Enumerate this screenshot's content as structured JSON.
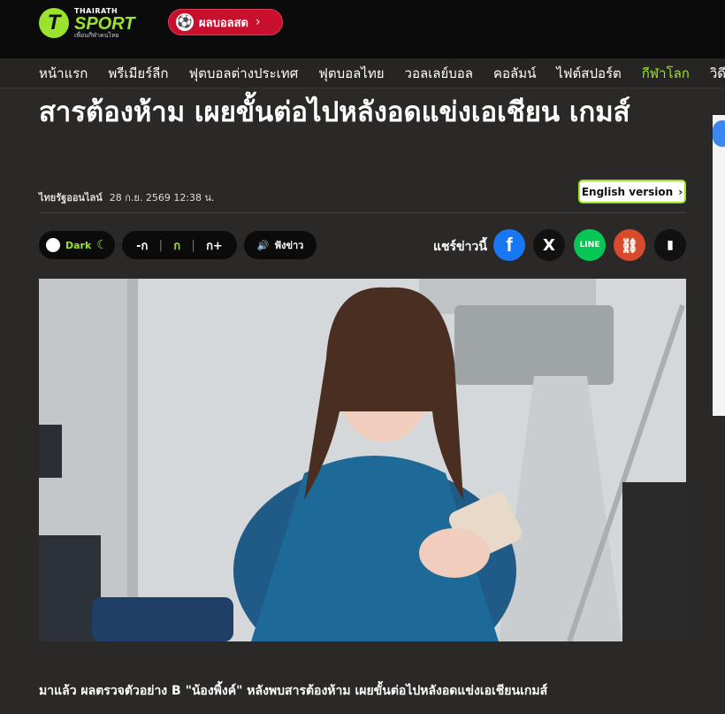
{
  "brand": {
    "name_top": "THAIRATH",
    "name_main": "SPORT",
    "tagline": "เพื่อนกีฬาคนไทย",
    "logo_letter": "T",
    "accent": "#9be22d"
  },
  "live_button": {
    "label": "ผลบอลสด",
    "icon": "football-icon"
  },
  "nav": {
    "items": [
      {
        "label": "หน้าแรก",
        "active": false
      },
      {
        "label": "พรีเมียร์ลีก",
        "active": false
      },
      {
        "label": "ฟุตบอลต่างประเทศ",
        "active": false
      },
      {
        "label": "ฟุตบอลไทย",
        "active": false
      },
      {
        "label": "วอลเลย์บอล",
        "active": false
      },
      {
        "label": "คอลัมน์",
        "active": false
      },
      {
        "label": "ไฟต์สปอร์ต",
        "active": false
      },
      {
        "label": "กีฬาโลก",
        "active": true
      },
      {
        "label": "วิดีโอ",
        "active": false
      }
    ]
  },
  "article": {
    "headline": "สารต้องห้าม เผยขั้นต่อไปหลังอดแข่งเอเชียน เกมส์",
    "source": "ไทยรัฐออนไลน์",
    "timestamp": "28 ก.ย. 2569 12:38 น.",
    "english_button": "English version",
    "caption": "มาแล้ว ผลตรวจตัวอย่าง B \"น้องพิ้งค์\" หลังพบสารต้องห้าม เผยขั้นต่อไปหลังอดแข่งเอเชียนเกมส์"
  },
  "tools": {
    "dark_label": "Dark",
    "font_decrease": "-ก",
    "font_normal": "ก",
    "font_increase": "ก+",
    "listen_label": "ฟังข่าว"
  },
  "share": {
    "label": "แชร์ข่าวนี้",
    "facebook": "f",
    "x": "X",
    "line": "LINE",
    "link": "⛓",
    "bookmark": "▮"
  }
}
